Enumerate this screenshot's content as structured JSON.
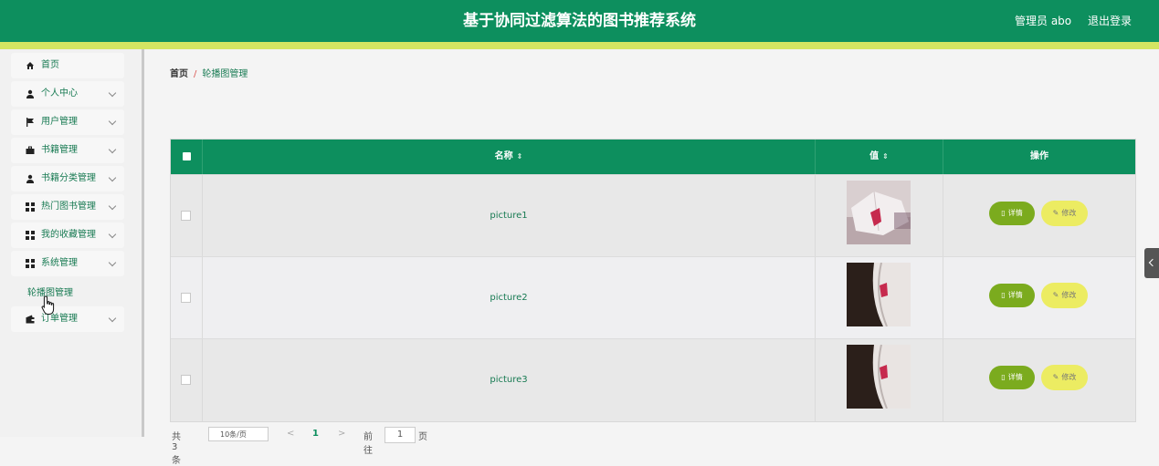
{
  "header": {
    "title": "基于协同过滤算法的图书推荐系统",
    "user_label": "管理员 abo",
    "logout_label": "退出登录"
  },
  "sidebar": {
    "items": [
      {
        "label": "首页",
        "icon": "home-icon"
      },
      {
        "label": "个人中心",
        "icon": "user-icon"
      },
      {
        "label": "用户管理",
        "icon": "flag-icon"
      },
      {
        "label": "书籍管理",
        "icon": "briefcase-icon"
      },
      {
        "label": "书籍分类管理",
        "icon": "user-icon"
      },
      {
        "label": "热门图书管理",
        "icon": "grid-icon"
      },
      {
        "label": "我的收藏管理",
        "icon": "grid-icon"
      },
      {
        "label": "系统管理",
        "icon": "grid-icon"
      },
      {
        "label": "订单管理",
        "icon": "wallet-icon"
      }
    ],
    "subitem": "轮播图管理"
  },
  "breadcrumb": {
    "home": "首页",
    "separator": "/",
    "current": "轮播图管理"
  },
  "table": {
    "columns": [
      "名称",
      "值",
      "操作"
    ],
    "rows": [
      {
        "name": "picture1",
        "image": "open book with red bookmark"
      },
      {
        "name": "picture2",
        "image": "book pages on dark background"
      },
      {
        "name": "picture3",
        "image": "book pages on dark background"
      }
    ],
    "detail_label": "详情",
    "edit_label": "修改"
  },
  "pagination": {
    "total": "共 3 条",
    "page_size": "10条/页",
    "prev": "<",
    "current_page": "1",
    "next": ">",
    "goto_label": "前往",
    "goto_value": "1",
    "page_unit": "页"
  },
  "colors": {
    "header": "#0d8f5e",
    "header_stripe": "#d4e562",
    "accent_text": "#177a52",
    "detail_button": "#7bab1e",
    "edit_button": "#ecec62"
  }
}
